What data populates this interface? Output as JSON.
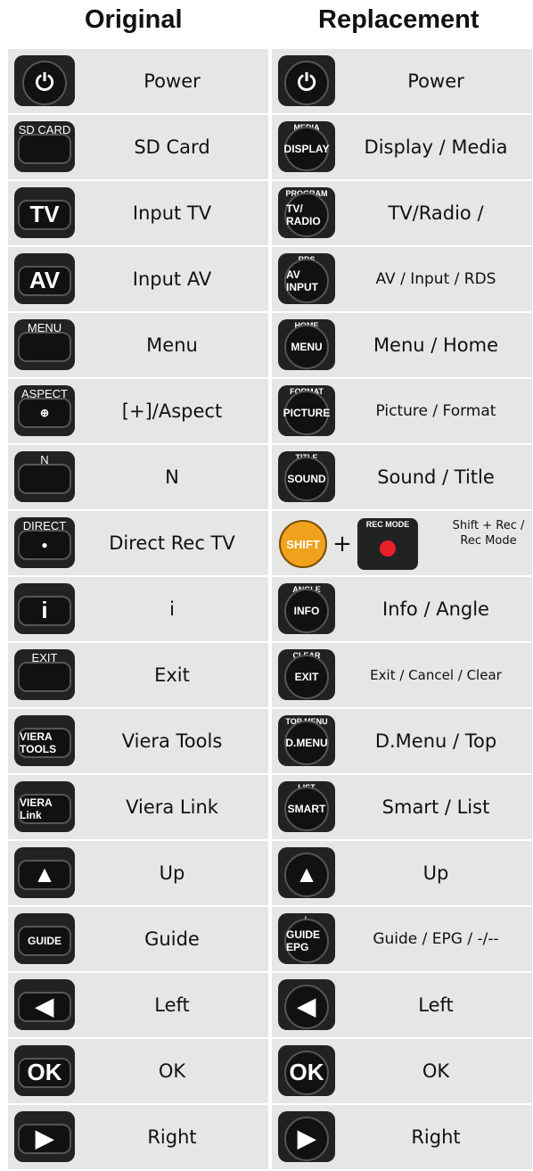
{
  "headers": {
    "original": "Original",
    "replacement": "Replacement"
  },
  "rows": [
    {
      "orig": {
        "label": "Power",
        "icon": "power-icon",
        "cap": "",
        "text": "⏻"
      },
      "repl": {
        "label": "Power",
        "icon": "power-icon",
        "cap": "",
        "text": "⏻"
      }
    },
    {
      "orig": {
        "label": "SD Card",
        "icon": "sd-card-button-icon",
        "cap": "SD CARD",
        "text": ""
      },
      "repl": {
        "label": "Display / Media",
        "icon": "display-button-icon",
        "cap": "MEDIA",
        "text": "DISPLAY"
      }
    },
    {
      "orig": {
        "label": "Input TV",
        "icon": "tv-button-icon",
        "cap": "",
        "text": "TV"
      },
      "repl": {
        "label": "TV/Radio /",
        "icon": "tv-radio-button-icon",
        "cap": "PROGRAM",
        "text": "TV/ RADIO"
      }
    },
    {
      "orig": {
        "label": "Input AV",
        "icon": "av-button-icon",
        "cap": "",
        "text": "AV"
      },
      "repl": {
        "label": "AV / Input / RDS",
        "icon": "av-input-button-icon",
        "cap": "RDS",
        "text": "AV INPUT"
      }
    },
    {
      "orig": {
        "label": "Menu",
        "icon": "menu-button-icon",
        "cap": "MENU",
        "text": ""
      },
      "repl": {
        "label": "Menu / Home",
        "icon": "menu-home-button-icon",
        "cap": "HOME",
        "text": "MENU"
      }
    },
    {
      "orig": {
        "label": "[+]/Aspect",
        "icon": "aspect-button-icon",
        "cap": "ASPECT",
        "text": "⊕"
      },
      "repl": {
        "label": "Picture / Format",
        "icon": "picture-button-icon",
        "cap": "FORMAT",
        "text": "PICTURE"
      }
    },
    {
      "orig": {
        "label": "N",
        "icon": "n-button-icon",
        "cap": "N",
        "text": ""
      },
      "repl": {
        "label": "Sound / Title",
        "icon": "sound-button-icon",
        "cap": "TITLE",
        "text": "SOUND"
      }
    },
    {
      "orig": {
        "label": "Direct Rec TV",
        "icon": "direct-tv-rec-button-icon",
        "cap": "DIRECT TV REC",
        "text": "●"
      },
      "repl": {
        "label": "Shift + Rec / Rec Mode",
        "icon": "shift-rec-button-icon",
        "cap": "REC MODE",
        "text": "SHIFT",
        "plus": "+"
      }
    },
    {
      "orig": {
        "label": "i",
        "icon": "info-i-button-icon",
        "cap": "",
        "text": "i"
      },
      "repl": {
        "label": "Info / Angle",
        "icon": "info-button-icon",
        "cap": "ANGLE",
        "text": "INFO"
      }
    },
    {
      "orig": {
        "label": "Exit",
        "icon": "exit-button-icon",
        "cap": "EXIT",
        "text": ""
      },
      "repl": {
        "label": "Exit / Cancel / Clear",
        "icon": "exit-clear-button-icon",
        "cap": "CLEAR",
        "text": "EXIT"
      }
    },
    {
      "orig": {
        "label": "Viera Tools",
        "icon": "viera-tools-button-icon",
        "cap": "",
        "text": "VIERA TOOLS"
      },
      "repl": {
        "label": "D.Menu / Top",
        "icon": "dmenu-button-icon",
        "cap": "TOP MENU",
        "text": "D.MENU"
      }
    },
    {
      "orig": {
        "label": "Viera Link",
        "icon": "viera-link-button-icon",
        "cap": "",
        "text": "VIERA Link"
      },
      "repl": {
        "label": "Smart / List",
        "icon": "smart-button-icon",
        "cap": "LIST",
        "text": "SMART"
      }
    },
    {
      "orig": {
        "label": "Up",
        "icon": "up-arrow-icon",
        "cap": "",
        "text": "▲"
      },
      "repl": {
        "label": "Up",
        "icon": "up-arrow-icon",
        "cap": "",
        "text": "▲"
      }
    },
    {
      "orig": {
        "label": "Guide",
        "icon": "guide-button-icon",
        "cap": "",
        "text": "GUIDE"
      },
      "repl": {
        "label": "Guide / EPG / -/--",
        "icon": "guide-epg-button-icon",
        "cap": "-/--",
        "text": "GUIDE EPG"
      }
    },
    {
      "orig": {
        "label": "Left",
        "icon": "left-arrow-icon",
        "cap": "",
        "text": "◀"
      },
      "repl": {
        "label": "Left",
        "icon": "left-arrow-icon",
        "cap": "",
        "text": "◀"
      }
    },
    {
      "orig": {
        "label": "OK",
        "icon": "ok-button-icon",
        "cap": "",
        "text": "OK"
      },
      "repl": {
        "label": "OK",
        "icon": "ok-button-icon",
        "cap": "",
        "text": "OK"
      }
    },
    {
      "orig": {
        "label": "Right",
        "icon": "right-arrow-icon",
        "cap": "",
        "text": "▶"
      },
      "repl": {
        "label": "Right",
        "icon": "right-arrow-icon",
        "cap": "",
        "text": "▶"
      }
    }
  ]
}
